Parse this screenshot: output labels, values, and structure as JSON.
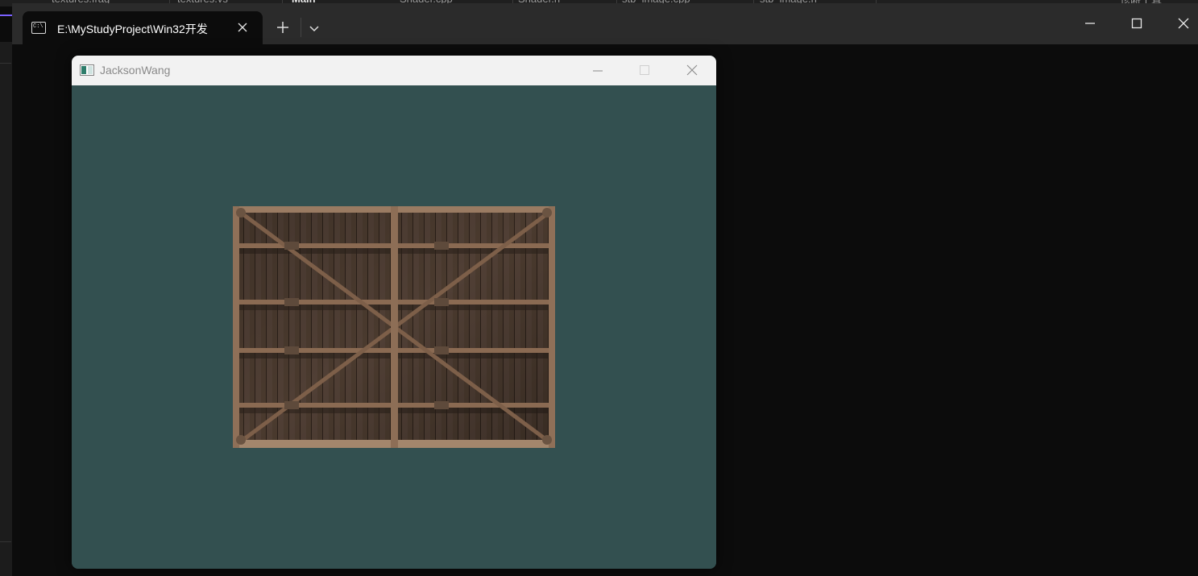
{
  "background_ide": {
    "tabs": [
      "textures.frag",
      "textures.vs",
      "Main",
      "Shader.cpp",
      "Shader.h",
      "stb_image.cpp",
      "stb_image.h",
      "诊断工具"
    ]
  },
  "terminal": {
    "tab_title": "E:\\MyStudyProject\\Win32开发",
    "tab_icon_text": "C:\\",
    "icons": {
      "tab": "terminal-icon",
      "close": "close-icon",
      "new_tab": "plus-icon",
      "dropdown": "chevron-down-icon",
      "minimize": "minimize-icon",
      "maximize": "maximize-icon",
      "window_close": "close-icon"
    }
  },
  "app_window": {
    "title": "JacksonWang",
    "clear_color": "#335050",
    "texture_name": "wooden-container-texture"
  },
  "colors": {
    "terminal_bg": "#0c0c0c",
    "titlebar_bg": "#2b2b2b",
    "app_titlebar_bg": "#f2f2f2",
    "accent": "#7b61ff"
  }
}
